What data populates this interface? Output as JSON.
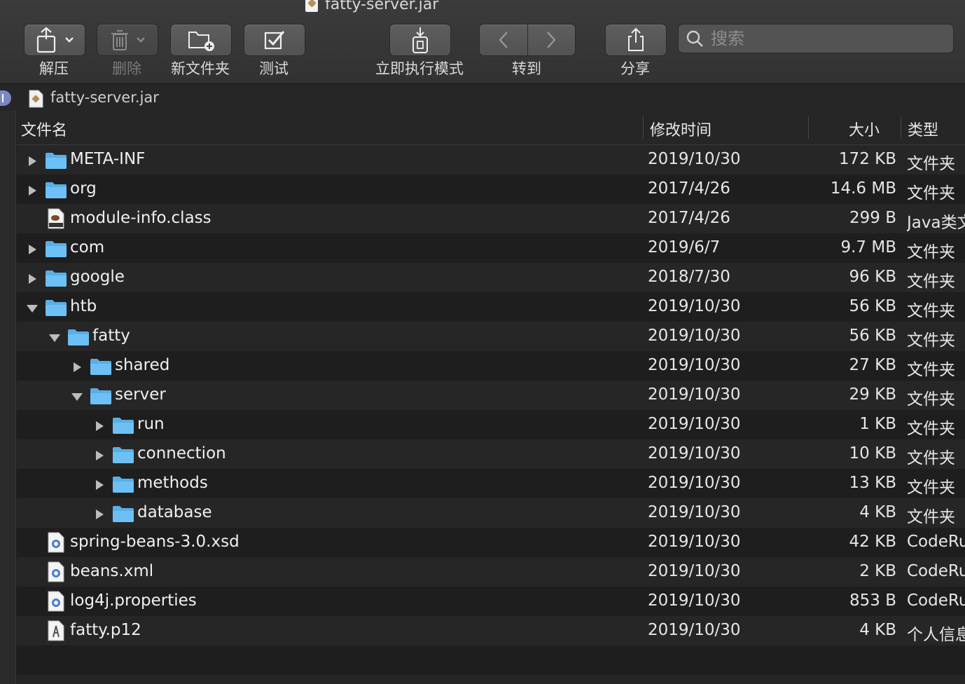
{
  "window": {
    "title": "fatty-server.jar"
  },
  "toolbar": {
    "extract_label": "解压",
    "delete_label": "删除",
    "new_folder_label": "新文件夹",
    "test_label": "测试",
    "exec_mode_label": "立即执行模式",
    "goto_label": "转到",
    "share_label": "分享",
    "search_placeholder": "搜索"
  },
  "path": {
    "current": "fatty-server.jar"
  },
  "columns": {
    "name": "文件名",
    "modified": "修改时间",
    "size": "大小",
    "type": "类型"
  },
  "rows": [
    {
      "name": "META-INF",
      "date": "2019/10/30",
      "size": "172 KB",
      "type": "文件夹",
      "depth": 0,
      "kind": "folder",
      "expand": "closed"
    },
    {
      "name": "org",
      "date": "2017/4/26",
      "size": "14.6 MB",
      "type": "文件夹",
      "depth": 0,
      "kind": "folder",
      "expand": "closed"
    },
    {
      "name": "module-info.class",
      "date": "2017/4/26",
      "size": "299 B",
      "type": "Java类文件",
      "depth": 0,
      "kind": "class",
      "expand": "none"
    },
    {
      "name": "com",
      "date": "2019/6/7",
      "size": "9.7 MB",
      "type": "文件夹",
      "depth": 0,
      "kind": "folder",
      "expand": "closed"
    },
    {
      "name": "google",
      "date": "2018/7/30",
      "size": "96 KB",
      "type": "文件夹",
      "depth": 0,
      "kind": "folder",
      "expand": "closed"
    },
    {
      "name": "htb",
      "date": "2019/10/30",
      "size": "56 KB",
      "type": "文件夹",
      "depth": 0,
      "kind": "folder",
      "expand": "open"
    },
    {
      "name": "fatty",
      "date": "2019/10/30",
      "size": "56 KB",
      "type": "文件夹",
      "depth": 1,
      "kind": "folder",
      "expand": "open"
    },
    {
      "name": "shared",
      "date": "2019/10/30",
      "size": "27 KB",
      "type": "文件夹",
      "depth": 2,
      "kind": "folder",
      "expand": "closed"
    },
    {
      "name": "server",
      "date": "2019/10/30",
      "size": "29 KB",
      "type": "文件夹",
      "depth": 2,
      "kind": "folder",
      "expand": "open"
    },
    {
      "name": "run",
      "date": "2019/10/30",
      "size": "1 KB",
      "type": "文件夹",
      "depth": 3,
      "kind": "folder",
      "expand": "closed"
    },
    {
      "name": "connection",
      "date": "2019/10/30",
      "size": "10 KB",
      "type": "文件夹",
      "depth": 3,
      "kind": "folder",
      "expand": "closed"
    },
    {
      "name": "methods",
      "date": "2019/10/30",
      "size": "13 KB",
      "type": "文件夹",
      "depth": 3,
      "kind": "folder",
      "expand": "closed"
    },
    {
      "name": "database",
      "date": "2019/10/30",
      "size": "4 KB",
      "type": "文件夹",
      "depth": 3,
      "kind": "folder",
      "expand": "closed"
    },
    {
      "name": "spring-beans-3.0.xsd",
      "date": "2019/10/30",
      "size": "42 KB",
      "type": "CodeRunner",
      "depth": 0,
      "kind": "code",
      "expand": "none"
    },
    {
      "name": "beans.xml",
      "date": "2019/10/30",
      "size": "2 KB",
      "type": "CodeRunner",
      "depth": 0,
      "kind": "code",
      "expand": "none"
    },
    {
      "name": "log4j.properties",
      "date": "2019/10/30",
      "size": "853 B",
      "type": "CodeRunner",
      "depth": 0,
      "kind": "code",
      "expand": "none"
    },
    {
      "name": "fatty.p12",
      "date": "2019/10/30",
      "size": "4 KB",
      "type": "个人信息",
      "depth": 0,
      "kind": "cert",
      "expand": "none"
    }
  ]
}
